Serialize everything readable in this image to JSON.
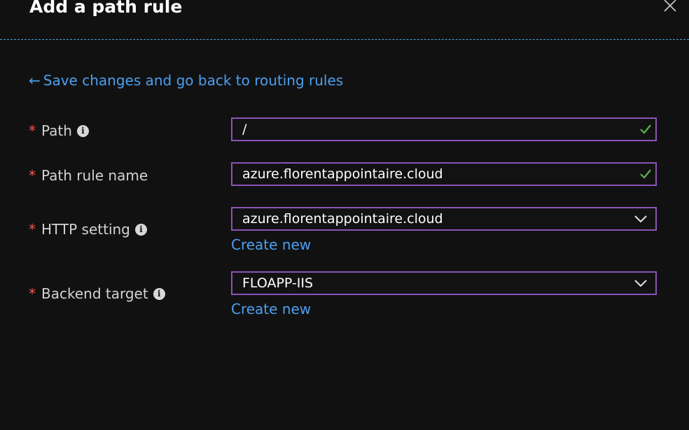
{
  "panel": {
    "title": "Add a path rule"
  },
  "back_link": {
    "arrow": "←",
    "label": "Save changes and go back to routing rules"
  },
  "form": {
    "required_mark": "*",
    "info_glyph": "i",
    "path": {
      "label": "Path",
      "value": "/",
      "valid": true
    },
    "path_rule_name": {
      "label": "Path rule name",
      "value": "azure.florentappointaire.cloud",
      "valid": true
    },
    "http_setting": {
      "label": "HTTP setting",
      "selected": "azure.florentappointaire.cloud",
      "create_new": "Create new"
    },
    "backend_target": {
      "label": "Backend target",
      "selected": "FLOAPP-IIS",
      "create_new": "Create new"
    }
  },
  "colors": {
    "background": "#111112",
    "accent_link": "#4ba0f0",
    "field_border": "#8b53b8",
    "required": "#ef5a4c",
    "valid_check": "#5bb34a",
    "divider": "#4aa3d9"
  }
}
